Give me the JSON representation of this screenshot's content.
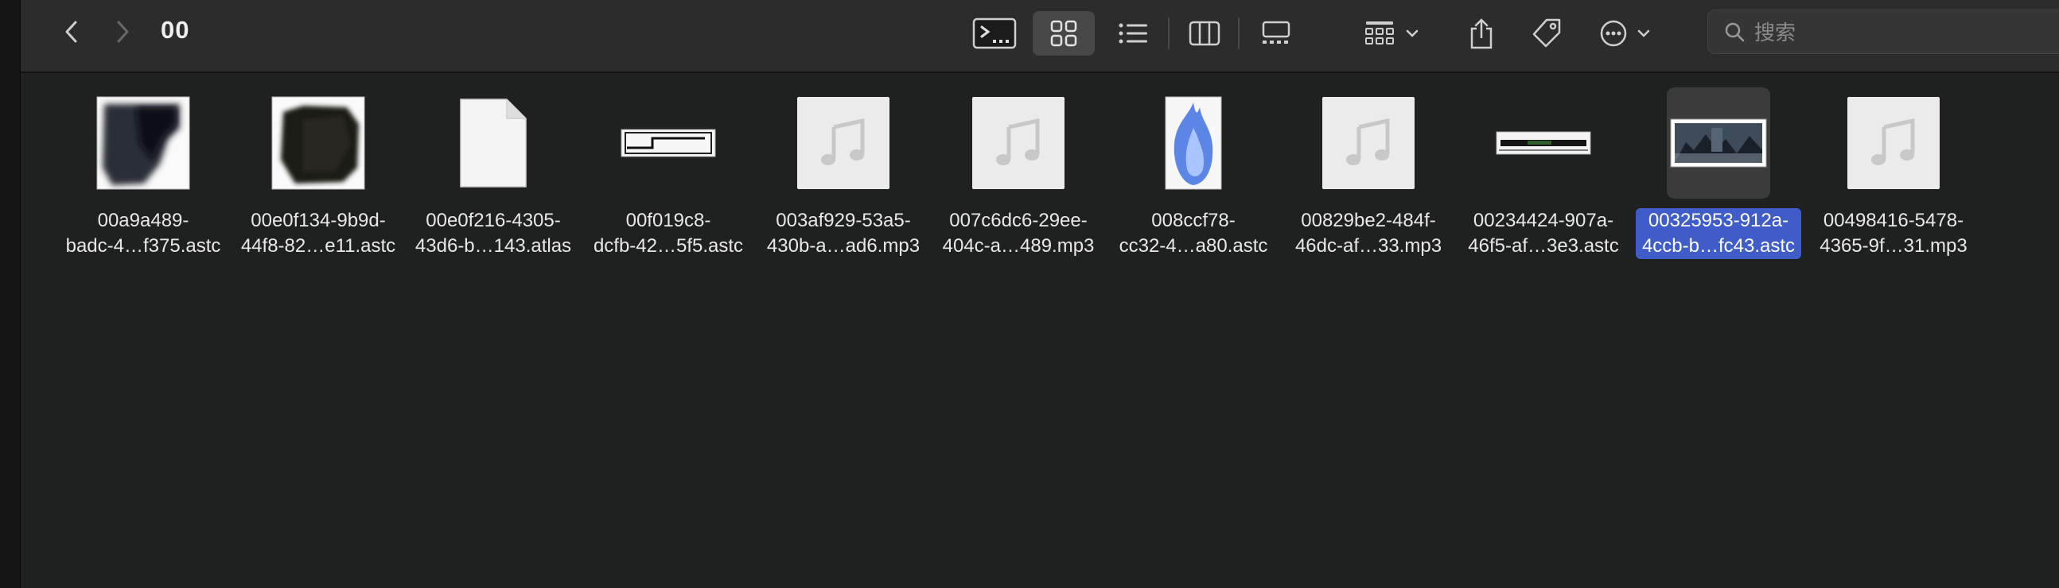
{
  "window": {
    "title": "00"
  },
  "toolbar": {
    "back_label": "‹",
    "forward_label": "›",
    "search_placeholder": "搜索"
  },
  "files": [
    {
      "line1": "00a9a489-",
      "line2": "badc-4…f375.astc"
    },
    {
      "line1": "00e0f134-9b9d-",
      "line2": "44f8-82…e11.astc"
    },
    {
      "line1": "00e0f216-4305-",
      "line2": "43d6-b…143.atlas"
    },
    {
      "line1": "00f019c8-",
      "line2": "dcfb-42…5f5.astc"
    },
    {
      "line1": "003af929-53a5-",
      "line2": "430b-a…ad6.mp3"
    },
    {
      "line1": "007c6dc6-29ee-",
      "line2": "404c-a…489.mp3"
    },
    {
      "line1": "008ccf78-",
      "line2": "cc32-4…a80.astc"
    },
    {
      "line1": "00829be2-484f-",
      "line2": "46dc-af…33.mp3"
    },
    {
      "line1": "00234424-907a-",
      "line2": "46f5-af…3e3.astc"
    },
    {
      "line1": "00325953-912a-",
      "line2": "4ccb-b…fc43.astc",
      "selected": true
    },
    {
      "line1": "00498416-5478-",
      "line2": "4365-9f…31.mp3"
    }
  ],
  "colors": {
    "selection": "#3f5cc9",
    "toolbar_bg": "#2c2c2c",
    "content_bg": "#1f2020"
  }
}
